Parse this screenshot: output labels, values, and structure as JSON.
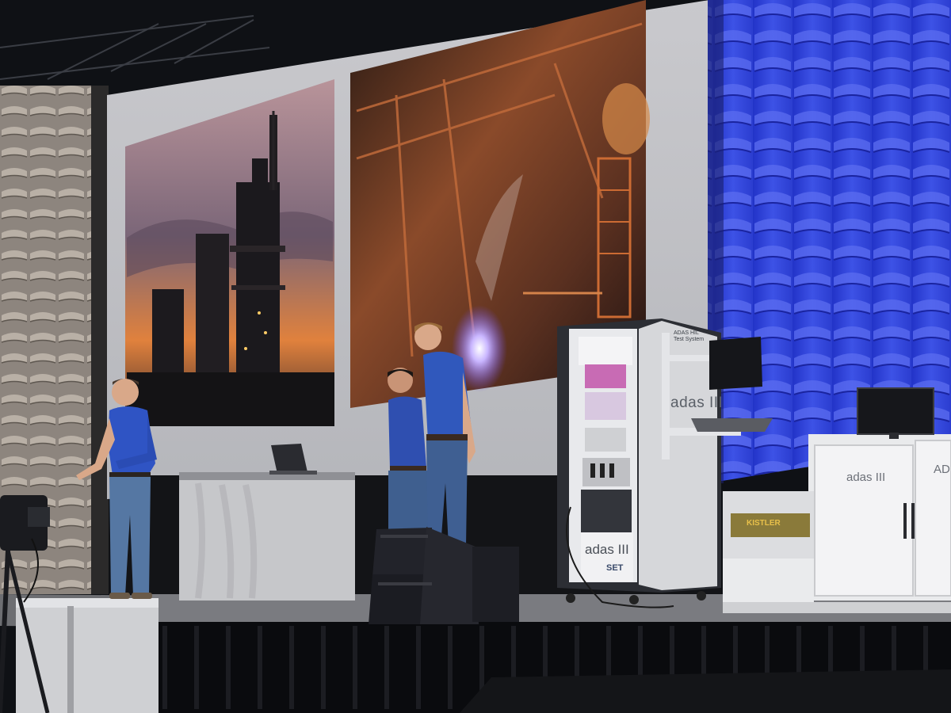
{
  "scene": {
    "description_free": true,
    "rack": {
      "title_line1": "ADAS HIL",
      "title_line2": "Test System",
      "side_logo": "adas III",
      "front_logo": "adas III",
      "vendor": "SET"
    },
    "cabinet": {
      "logo": "adas III",
      "logo_partial": "AD",
      "sticker": "KISTLER"
    }
  },
  "colors": {
    "wall_blue": "#2a3fd8",
    "shirt_blue": "#2f4fb0",
    "sunset_orange": "#e07a3a",
    "stage_black": "#0a0b0e"
  }
}
